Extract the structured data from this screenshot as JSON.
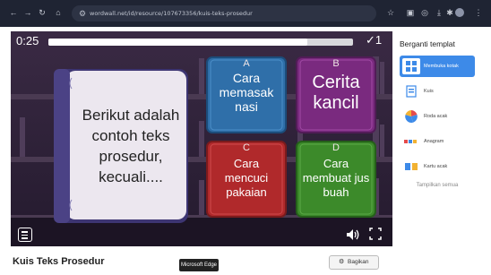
{
  "browser": {
    "url": "wordwall.net/id/resource/107673356/kuis-teks-prosedur",
    "nav_icons": [
      "arrow-left-icon",
      "arrow-right-icon",
      "reload-icon",
      "home-icon"
    ],
    "toolbar_icons": [
      "star-icon",
      "window-icon",
      "extension-icon",
      "download-icon",
      "puzzle-icon",
      "menu-dots-icon"
    ]
  },
  "game": {
    "timer": "0:25",
    "progress": 0.85,
    "score_check": "✓",
    "score": "1",
    "question": "Berikut adalah contoh teks prosedur, kecuali....",
    "answers": [
      {
        "letter": "A",
        "text": "Cara memasak nasi",
        "color": "#2f6fa9"
      },
      {
        "letter": "B",
        "text": "Cerita kancil",
        "color": "#7a2a7f"
      },
      {
        "letter": "C",
        "text": "Cara mencuci pakaian",
        "color": "#b0292b"
      },
      {
        "letter": "D",
        "text": "Cara membuat jus buah",
        "color": "#3c8a2a"
      }
    ]
  },
  "footer": {
    "title": "Kuis Teks Prosedur",
    "tooltip": "Microsoft Edge",
    "share_label": "Bagikan"
  },
  "sidebar": {
    "title": "Berganti templat",
    "templates": [
      {
        "label": "Membuka kotak",
        "active": true
      },
      {
        "label": "Kuis",
        "active": false
      },
      {
        "label": "Roda acak",
        "active": false
      },
      {
        "label": "Anagram",
        "active": false
      },
      {
        "label": "Kartu acak",
        "active": false
      }
    ],
    "show_all": "Tampilkan semua"
  },
  "colors": {
    "accent": "#3d8ae8",
    "game_bg": "#2e2036",
    "browser_bar": "#1f2433"
  }
}
